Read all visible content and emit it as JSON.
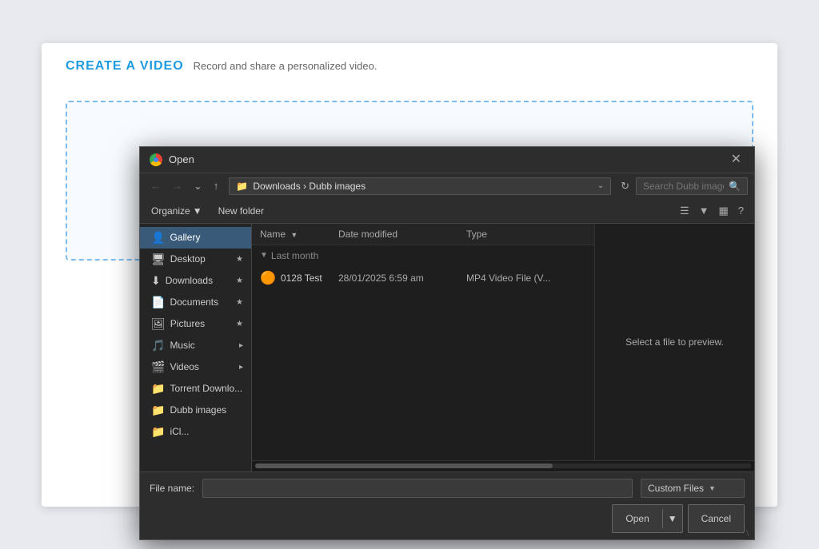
{
  "page": {
    "title": "CREATE A VIDEO",
    "subtitle": "Record and share a personalized video."
  },
  "dialog": {
    "title": "Open",
    "chrome_label": "G",
    "close_btn": "✕",
    "address": {
      "path": "Downloads › Dubb images",
      "parts": [
        "Downloads",
        "Dubb images"
      ],
      "search_placeholder": "Search Dubb images"
    },
    "toolbar": {
      "organize_label": "Organize",
      "new_folder_label": "New folder"
    },
    "sidebar": {
      "items": [
        {
          "id": "gallery",
          "label": "Gallery",
          "icon": "👤",
          "active": true,
          "pinnable": false
        },
        {
          "id": "desktop",
          "label": "Desktop",
          "icon": "🖥",
          "active": false,
          "pin": "★"
        },
        {
          "id": "downloads",
          "label": "Downloads",
          "icon": "⬇",
          "active": false,
          "pin": "★"
        },
        {
          "id": "documents",
          "label": "Documents",
          "icon": "📄",
          "active": false,
          "pin": "★"
        },
        {
          "id": "pictures",
          "label": "Pictures",
          "icon": "🖼",
          "active": false,
          "pin": "★"
        },
        {
          "id": "music",
          "label": "Music",
          "icon": "🎵",
          "active": false,
          "pin": "▸"
        },
        {
          "id": "videos",
          "label": "Videos",
          "icon": "🎬",
          "active": false,
          "pin": "▸"
        },
        {
          "id": "torrent",
          "label": "Torrent Downlo...",
          "icon": "📁",
          "active": false,
          "pin": ""
        },
        {
          "id": "dubb",
          "label": "Dubb images",
          "icon": "📁",
          "active": false,
          "pin": ""
        },
        {
          "id": "icloud",
          "label": "iCl...",
          "icon": "📁",
          "active": false,
          "pin": ""
        }
      ]
    },
    "file_list": {
      "columns": [
        {
          "id": "name",
          "label": "Name",
          "sortable": true
        },
        {
          "id": "date_modified",
          "label": "Date modified",
          "sortable": true
        },
        {
          "id": "type",
          "label": "Type",
          "sortable": true
        }
      ],
      "groups": [
        {
          "label": "Last month",
          "expanded": true,
          "files": [
            {
              "name": "0128 Test",
              "icon": "🟠",
              "date_modified": "28/01/2025 6:59 am",
              "type": "MP4 Video File (V..."
            }
          ]
        }
      ]
    },
    "preview": {
      "text": "Select a file to preview."
    },
    "bottom": {
      "filename_label": "File name:",
      "filename_value": "",
      "filetype_label": "Custom Files",
      "open_label": "Open",
      "cancel_label": "Cancel"
    }
  }
}
